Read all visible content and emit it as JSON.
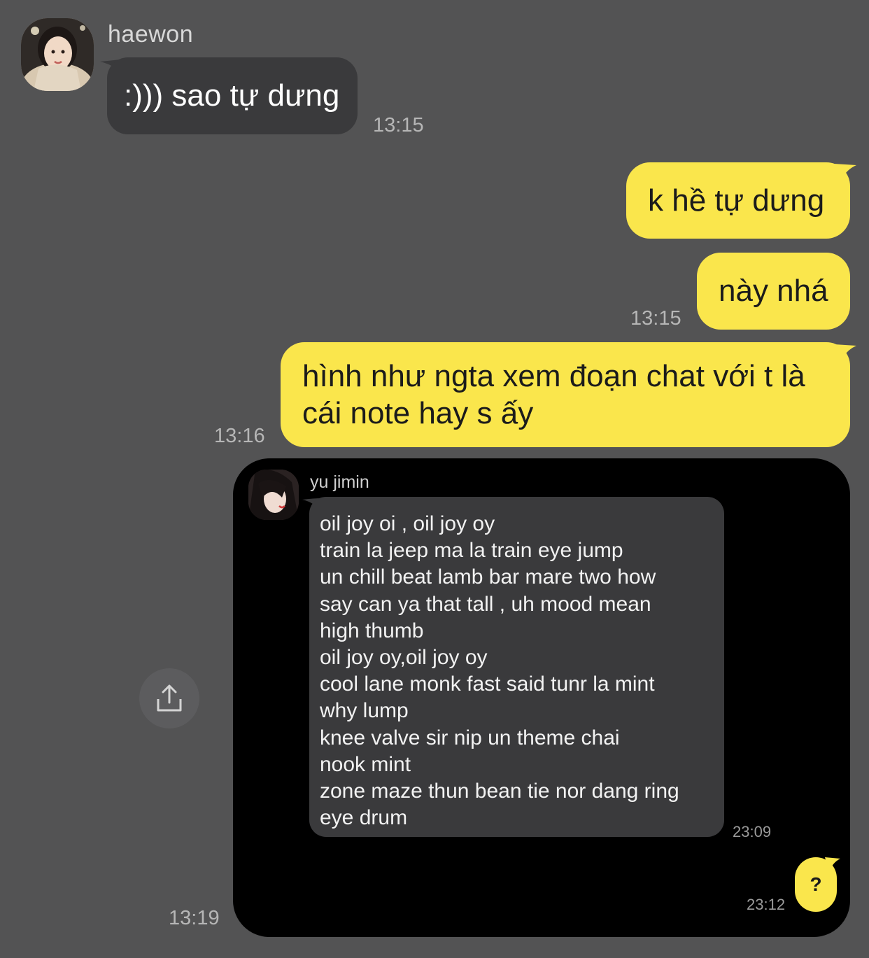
{
  "contact": {
    "name": "haewon"
  },
  "messages": {
    "incoming_1": {
      "text": ":))) sao tự dưng",
      "time": "13:15"
    },
    "outgoing_1": {
      "text": "k hề tự dưng"
    },
    "outgoing_2": {
      "text": "này nhá",
      "time": "13:15"
    },
    "outgoing_3": {
      "lines": [
        "hình như ngta xem đoạn chat với t là",
        "cái note hay s ấy"
      ],
      "time": "13:16"
    },
    "image_message": {
      "time": "13:19"
    }
  },
  "shared_screenshot": {
    "sender_name": "yu jimin",
    "lines": [
      "oil joy oi , oil joy oy",
      "train la jeep ma la train eye jump",
      "un chill beat lamb bar mare two how",
      "say can ya that tall , uh mood mean",
      "high thumb",
      "oil joy oy,oil joy oy",
      "cool lane monk fast said tunr la mint",
      "why lump",
      "knee valve sir nip un theme chai",
      "nook mint",
      "zone maze thun bean tie nor dang ring",
      "eye drum"
    ],
    "incoming_time": "23:09",
    "reply_text": "?",
    "reply_time": "23:12"
  },
  "colors": {
    "background": "#535354",
    "incoming_bubble": "#3a3a3c",
    "outgoing_bubble": "#fae64c",
    "timestamp": "#b6b6b6"
  },
  "icons": {
    "share": "share-icon"
  }
}
